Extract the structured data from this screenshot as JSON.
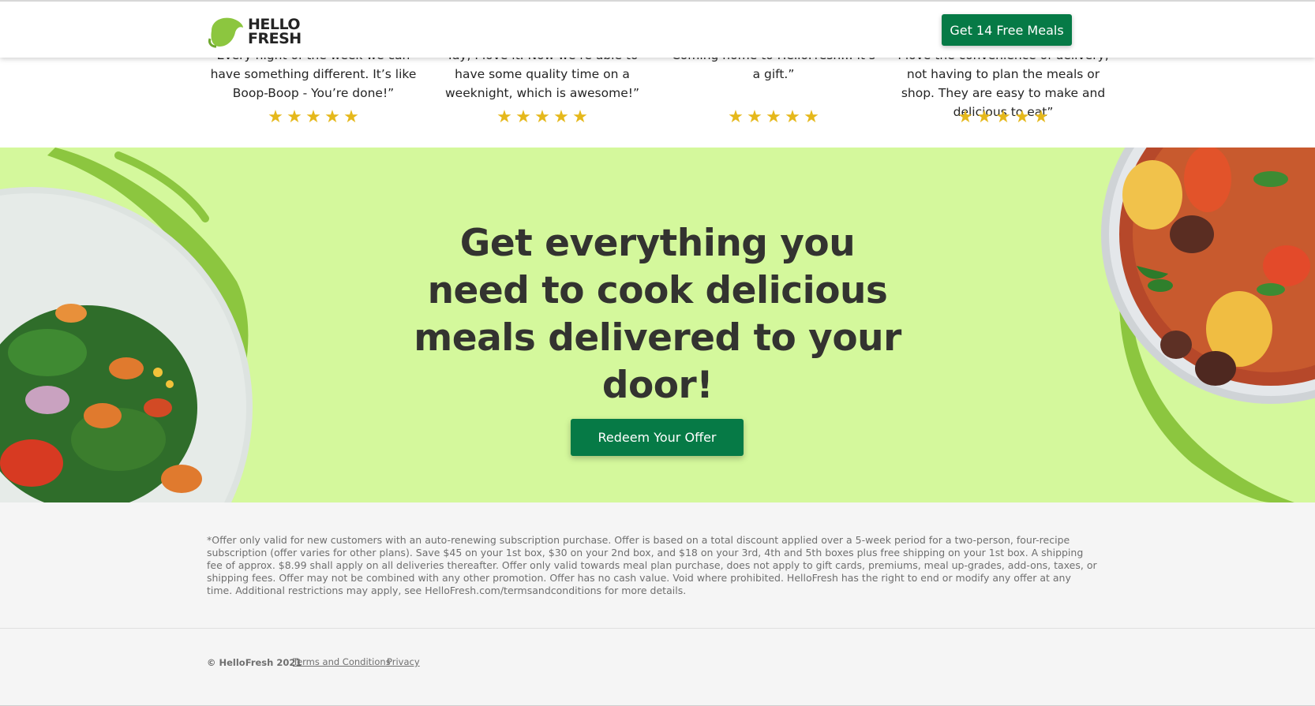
{
  "header": {
    "logo_line1": "HELLO",
    "logo_line2": "FRESH",
    "cta_label": "Get 14 Free Meals"
  },
  "testimonials": [
    {
      "quote": "Every night of the week we can have something different. It’s like Boop-Boop - You’re done!”",
      "rating": 5
    },
    {
      "quote": "Yay, I love it. Now we’re able to have some quality time on a weeknight, which is awesome!”",
      "rating": 5
    },
    {
      "quote": "Coming home to HelloFresh… it’s a gift.”",
      "rating": 5
    },
    {
      "quote": "I love the convenience of delivery, not having to plan the meals or shop. They are easy to make and delicious to eat”",
      "rating": 5
    }
  ],
  "hero": {
    "headline": "Get everything you need to cook delicious meals delivered to your door!",
    "cta_label": "Redeem Your Offer"
  },
  "disclaimer": "*Offer only valid for new customers with an auto-renewing subscription purchase. Offer is based on a total discount applied over a 5-week period for a two-person, four-recipe subscription (offer varies for other plans). Save $45 on your 1st box, $30 on your 2nd box, and $18 on your 3rd, 4th and 5th boxes plus free shipping on your 1st box. A shipping fee of approx. $8.99 shall apply on all deliveries thereafter. Offer only valid towards meal plan purchase, does not apply to gift cards, premiums, meal up-grades, add-ons, taxes, or shipping fees. Offer may not be combined with any other promotion. Offer has no cash value. Void where prohibited. HelloFresh has the right to end or modify any offer at any time. Additional restrictions may apply, see HelloFresh.com/termsandconditions for more details.",
  "footer": {
    "copyright": "© HelloFresh 2021",
    "terms_label": "Terms and Conditions",
    "privacy_label": "Privacy"
  },
  "colors": {
    "brand_green": "#067a46",
    "hero_bg": "#d4f89c",
    "lime": "#8cc63f",
    "star": "#e5b81b"
  },
  "icons": [
    "lime-logo-icon",
    "star-icon"
  ]
}
